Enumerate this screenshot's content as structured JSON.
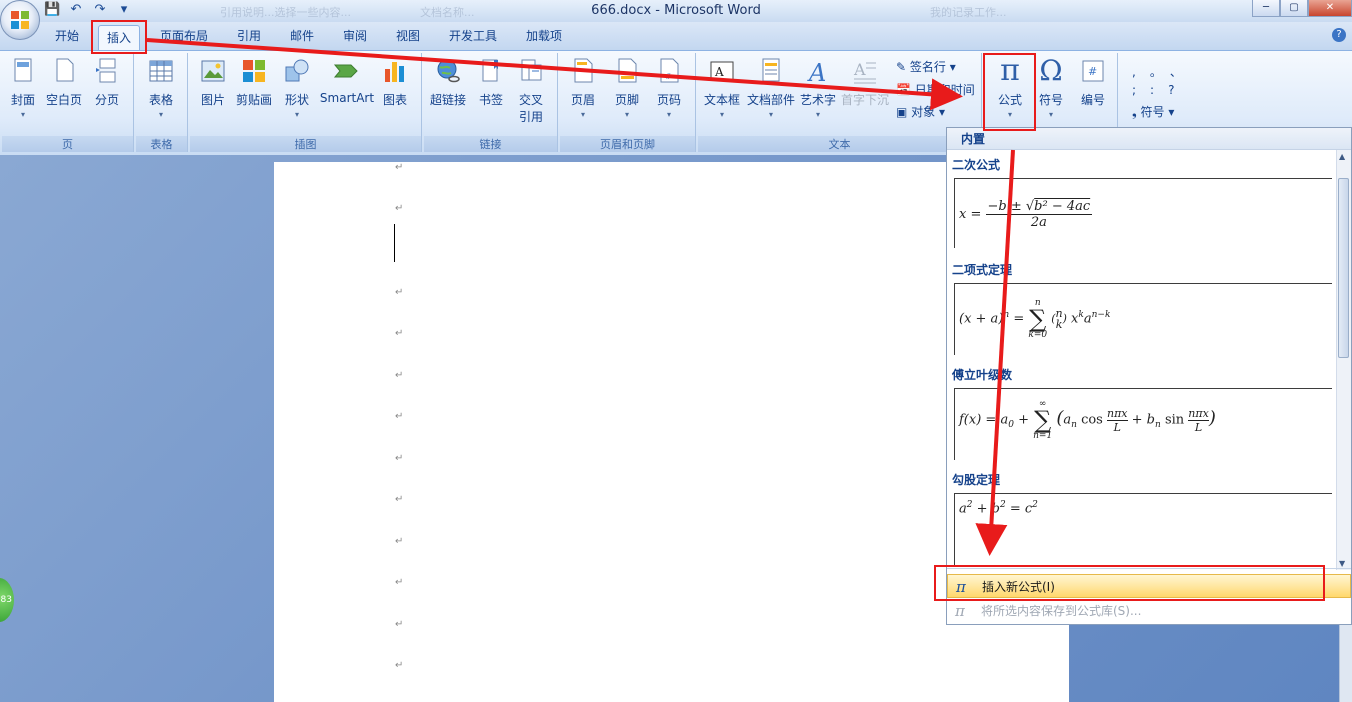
{
  "window": {
    "title": "666.docx - Microsoft Word",
    "faded_tabs": [
      "引用说明...选择一些内容...",
      "文档名称...",
      "我的记录工作..."
    ]
  },
  "tabs": [
    "开始",
    "插入",
    "页面布局",
    "引用",
    "邮件",
    "审阅",
    "视图",
    "开发工具",
    "加载项"
  ],
  "ribbon": {
    "groups": {
      "page": {
        "label": "页",
        "buttons": [
          "封面",
          "空白页",
          "分页"
        ]
      },
      "table": {
        "label": "表格",
        "buttons": [
          "表格"
        ]
      },
      "illustrations": {
        "label": "插图",
        "buttons": [
          "图片",
          "剪贴画",
          "形状",
          "SmartArt",
          "图表"
        ]
      },
      "links": {
        "label": "链接",
        "buttons": [
          "超链接",
          "书签",
          "交叉",
          "引用"
        ]
      },
      "header_footer": {
        "label": "页眉和页脚",
        "buttons": [
          "页眉",
          "页脚",
          "页码"
        ]
      },
      "text": {
        "label": "文本",
        "buttons": [
          "文本框",
          "文档部件",
          "艺术字",
          "首字下沉"
        ],
        "small": [
          "签名行",
          "日期和时间",
          "对象"
        ]
      },
      "symbols": {
        "buttons": [
          "公式",
          "符号",
          "编号"
        ],
        "special_symbols": "符号",
        "punct": [
          ",",
          "。",
          "、",
          ";",
          ":",
          "?"
        ]
      }
    }
  },
  "equation_panel": {
    "header": "内置",
    "sections": [
      {
        "title": "二次公式"
      },
      {
        "title": "二项式定理"
      },
      {
        "title": "傅立叶级数"
      },
      {
        "title": "勾股定理"
      }
    ],
    "menu": {
      "insert_new": "插入新公式(I)",
      "save_selection": "将所选内容保存到公式库(S)..."
    }
  },
  "badge": "83",
  "colors": {
    "annotation_red": "#e81b1b",
    "ribbon_text": "#15428b",
    "highlight": "#ffe7a2"
  }
}
